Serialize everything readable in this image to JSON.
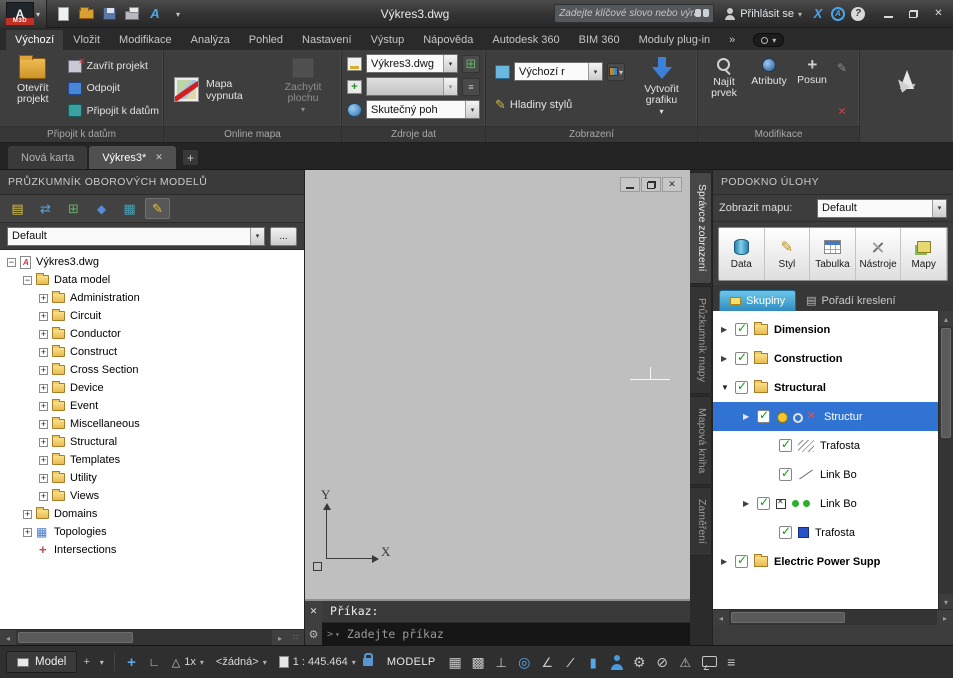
{
  "colors": {
    "selection_blue": "#3173d2",
    "check_green": "#119c11",
    "groups_tab_teal": "#3f9fcf",
    "canvas_gray": "#bfbfbf",
    "danger_red": "#d22020",
    "accent_blue": "#4aa6e8"
  },
  "titlebar": {
    "app_badge": "M3D",
    "title": "Výkres3.dwg",
    "search_placeholder": "Zadejte klíčové slovo nebo výraz.",
    "signin_label": "Přihlásit se",
    "qat_icons": [
      {
        "name": "new-file-icon",
        "g": "q-new"
      },
      {
        "name": "open-file-icon",
        "g": "q-open"
      },
      {
        "name": "save-icon",
        "g": "q-save"
      },
      {
        "name": "plot-icon",
        "g": "q-print"
      },
      {
        "name": "autodesk-360-icon",
        "g": "q-a"
      },
      {
        "name": "qat-customize-icon",
        "g": "q-chev"
      }
    ]
  },
  "ribbon_tabs": [
    {
      "label": "Výchozí",
      "cls": "active"
    },
    {
      "label": "Vložit"
    },
    {
      "label": "Modifikace"
    },
    {
      "label": "Analýza"
    },
    {
      "label": "Pohled"
    },
    {
      "label": "Nastavení"
    },
    {
      "label": "Výstup"
    },
    {
      "label": "Nápověda"
    },
    {
      "label": "Autodesk 360"
    },
    {
      "label": "BIM 360"
    },
    {
      "label": "Moduly plug-in"
    },
    {
      "label": "»"
    }
  ],
  "ribbon": {
    "connect_panel": {
      "title": "Připojit k datům",
      "open_project": "Otevřít projekt",
      "close_project": "Zavřít projekt",
      "disconnect": "Odpojit",
      "connect_data": "Připojit k datům"
    },
    "online_map_panel": {
      "title": "Online mapa",
      "map_off": "Mapa vypnuta",
      "capture_area": "Zachytit plochu"
    },
    "data_sources_panel": {
      "title": "Zdroje dat",
      "drawing_combo": "Výkres3.dwg",
      "mode_combo": "Skutečný poh"
    },
    "display_panel": {
      "title": "Zobrazení",
      "display_combo": "Výchozí r",
      "style_layers": "Hladiny stylů",
      "create_graphics": "Vytvořit grafiku"
    },
    "modify_panel": {
      "title": "Modifikace",
      "find_feature": "Najít prvek",
      "attributes": "Atributy",
      "move": "Posun"
    }
  },
  "doc_tabs": {
    "new_tab": "Nová karta",
    "active_tab": "Výkres3*"
  },
  "explorer": {
    "title": "PRŮZKUMNÍK OBOROVÝCH MODELŮ",
    "combo_value": "Default",
    "more_button": "...",
    "toolbar_icons": [
      {
        "name": "open-model-icon",
        "g": "e-doc"
      },
      {
        "name": "model-refresh-icon",
        "g": "e-arrows"
      },
      {
        "name": "model-add-icon",
        "g": "e-plus"
      },
      {
        "name": "goto-feature-icon",
        "g": "e-diamond"
      },
      {
        "name": "topology-manager-icon",
        "g": "e-grid"
      },
      {
        "name": "edit-style-icon",
        "g": "e-pencil",
        "cls": "pressed"
      }
    ],
    "tree": [
      {
        "label": "Výkres3.dwg",
        "indcls": "ind0",
        "expcls": "minus",
        "icon": "dwg"
      },
      {
        "label": "Data model",
        "indcls": "ind1",
        "expcls": "minus",
        "icon": "folder"
      },
      {
        "label": "Administration",
        "indcls": "ind2",
        "expcls": "plus",
        "icon": "folder"
      },
      {
        "label": "Circuit",
        "indcls": "ind2",
        "expcls": "plus",
        "icon": "folder"
      },
      {
        "label": "Conductor",
        "indcls": "ind2",
        "expcls": "plus",
        "icon": "folder"
      },
      {
        "label": "Construct",
        "indcls": "ind2",
        "expcls": "plus",
        "icon": "folder"
      },
      {
        "label": "Cross Section",
        "indcls": "ind2",
        "expcls": "plus",
        "icon": "folder"
      },
      {
        "label": "Device",
        "indcls": "ind2",
        "expcls": "plus",
        "icon": "folder"
      },
      {
        "label": "Event",
        "indcls": "ind2",
        "expcls": "plus",
        "icon": "folder"
      },
      {
        "label": "Miscellaneous",
        "indcls": "ind2",
        "expcls": "plus",
        "icon": "folder"
      },
      {
        "label": "Structural",
        "indcls": "ind2",
        "expcls": "plus",
        "icon": "folder"
      },
      {
        "label": "Templates",
        "indcls": "ind2",
        "expcls": "plus",
        "icon": "folder"
      },
      {
        "label": "Utility",
        "indcls": "ind2",
        "expcls": "plus",
        "icon": "folder"
      },
      {
        "label": "Views",
        "indcls": "ind2",
        "expcls": "plus",
        "icon": "folder"
      },
      {
        "label": "Domains",
        "indcls": "ind1",
        "expcls": "plus",
        "icon": "folder"
      },
      {
        "label": "Topologies",
        "indcls": "ind1",
        "expcls": "plus",
        "icon": "topology"
      },
      {
        "label": "Intersections",
        "indcls": "ind1",
        "expcls": "none",
        "icon": "intersection"
      }
    ]
  },
  "viewport": {
    "ucs_y_label": "Y",
    "ucs_x_label": "X",
    "command_prompt": "Příkaz:",
    "command_placeholder": "Zadejte příkaz"
  },
  "task_pane": {
    "title": "PODOKNO ÚLOHY",
    "show_map_label": "Zobrazit mapu:",
    "map_combo": "Default",
    "toolbar": [
      {
        "label": "Data",
        "icon": "t-data",
        "name": "data-icon"
      },
      {
        "label": "Styl",
        "icon": "t-style",
        "name": "style-icon"
      },
      {
        "label": "Tabulka",
        "icon": "t-table",
        "name": "table-icon"
      },
      {
        "label": "Nástroje",
        "icon": "t-tools",
        "name": "tools-icon"
      },
      {
        "label": "Mapy",
        "icon": "t-maps",
        "name": "maps-icon"
      }
    ],
    "groups_tab": "Skupiny",
    "draw_order_tab": "Pořadí kreslení",
    "layers": [
      {
        "label": "Dimension",
        "indcls": "rind0",
        "expcls": "right",
        "icon": "folder",
        "labcls": "bold"
      },
      {
        "label": "Construction",
        "indcls": "rind0",
        "expcls": "right",
        "icon": "folder",
        "labcls": "bold"
      },
      {
        "label": "Structural",
        "indcls": "rind0",
        "expcls": "down",
        "icon": "folder",
        "labcls": "bold"
      },
      {
        "label": "Structur",
        "indcls": "rind1",
        "expcls": "right",
        "icon": "sym-struct",
        "rowcls": "sel"
      },
      {
        "label": "Trafosta",
        "indcls": "rind2",
        "expcls": "none",
        "icon": "line-hatch"
      },
      {
        "label": "Link Bo",
        "indcls": "rind2",
        "expcls": "none",
        "icon": "line-thin"
      },
      {
        "label": "Link Bo",
        "indcls": "rind1",
        "expcls": "right",
        "icon": "sym-link"
      },
      {
        "label": "Trafosta",
        "indcls": "rind2",
        "expcls": "none",
        "icon": "sq-blue"
      },
      {
        "label": "Electric Power Supp",
        "indcls": "rind0",
        "expcls": "right",
        "icon": "folder",
        "labcls": "bold"
      }
    ],
    "side_tabs": [
      {
        "label": "Správce zobrazení",
        "cls": "active"
      },
      {
        "label": "Průzkumník mapy"
      },
      {
        "label": "Mapová kniha"
      },
      {
        "label": "Zaměření"
      }
    ]
  },
  "status_bar": {
    "model_label": "Model",
    "iso_label": "1x",
    "annotation_scale": "<žádná>",
    "viewport_scale": "1 : 445.464",
    "modelp_label": "MODELP",
    "left_icons": [
      {
        "name": "autosnap-marker-icon",
        "g": "g-crosshair g-blue"
      },
      {
        "name": "dynamic-ucs-icon",
        "g": "g-ortho"
      }
    ],
    "right_icons": [
      {
        "name": "grid-display-icon",
        "g": "g-grid"
      },
      {
        "name": "snap-mode-icon",
        "g": "g-snap"
      },
      {
        "name": "ortho-mode-icon",
        "g": "g-perp"
      },
      {
        "name": "geolocation-icon",
        "g": "g-geo g-blue"
      },
      {
        "name": "polar-tracking-icon",
        "g": "g-angle"
      },
      {
        "name": "lineweight-icon",
        "g": "g-slash"
      },
      {
        "name": "selection-cycling-icon",
        "g": "g-block g-blue"
      },
      {
        "name": "sign-in-status-icon",
        "g": "g-person"
      },
      {
        "name": "customization-gear-icon",
        "g": "g-gear"
      },
      {
        "name": "isolate-objects-icon",
        "g": "g-noaccess"
      },
      {
        "name": "graphics-performance-icon",
        "g": "g-warn"
      },
      {
        "name": "feedback-icon",
        "g": "g-chat"
      },
      {
        "name": "status-menu-icon",
        "g": "g-menu"
      }
    ]
  }
}
